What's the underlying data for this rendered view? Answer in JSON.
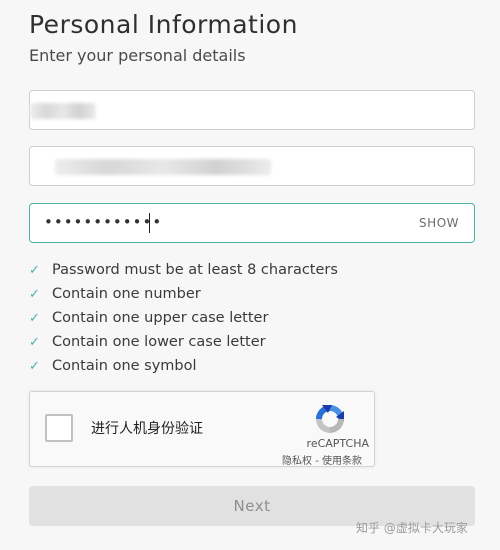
{
  "header": {
    "title": "Personal Information",
    "subtitle": "Enter your personal details"
  },
  "form": {
    "password": {
      "value": "••••••••••••",
      "show_label": "SHOW"
    },
    "rules": [
      "Password must be at least 8 characters",
      "Contain one number",
      "Contain one upper case letter",
      "Contain one lower case letter",
      "Contain one symbol"
    ],
    "rule_check_icon": "check-icon",
    "accent_color": "#48b3a6"
  },
  "captcha": {
    "label": "进行人机身份验证",
    "brand": "reCAPTCHA",
    "links": "隐私权 - 使用条款"
  },
  "actions": {
    "next_label": "Next"
  },
  "watermark": "知乎 @虚拟卡大玩家"
}
